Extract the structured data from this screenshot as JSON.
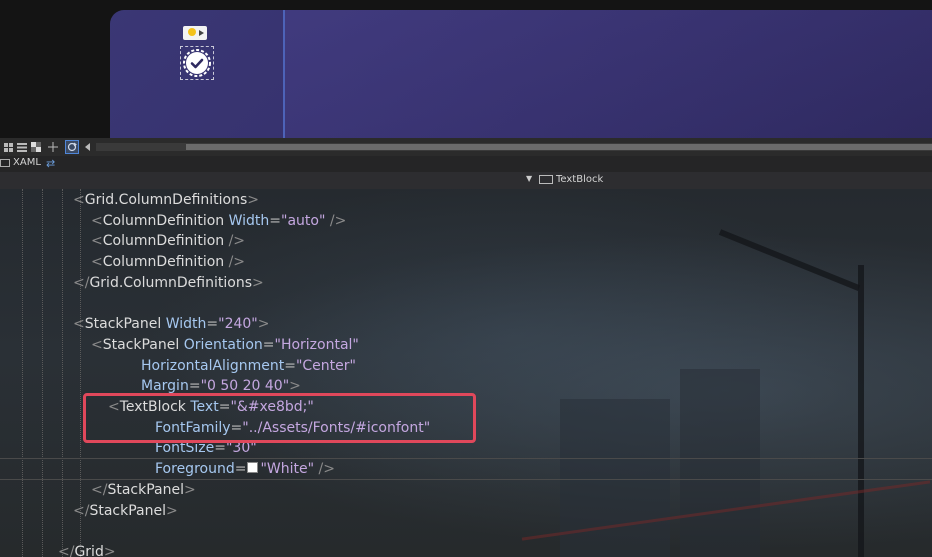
{
  "designer": {
    "icons": [
      "lightbulb-icon",
      "check-circle-icon"
    ]
  },
  "toolbar": {
    "buttons": [
      "grid-view-icon",
      "list-view-icon",
      "checker-icon",
      "crosshair-icon",
      "refresh-icon",
      "scroll-left-icon"
    ]
  },
  "tabs": {
    "xaml_label": "XAML",
    "swap_icon": "swap-icon"
  },
  "breadcrumb": {
    "element": "TextBlock"
  },
  "code": {
    "lines": [
      {
        "indent": 1,
        "parts": [
          [
            "tk",
            "<"
          ],
          [
            "tag",
            "Grid.ColumnDefinitions"
          ],
          [
            "tk",
            ">"
          ]
        ]
      },
      {
        "indent": 2,
        "parts": [
          [
            "tk",
            "<"
          ],
          [
            "tag",
            "ColumnDefinition "
          ],
          [
            "attr",
            "Width"
          ],
          [
            "eq",
            "="
          ],
          [
            "val",
            "\"auto\""
          ],
          [
            "tk",
            " />"
          ]
        ]
      },
      {
        "indent": 2,
        "parts": [
          [
            "tk",
            "<"
          ],
          [
            "tag",
            "ColumnDefinition "
          ],
          [
            "tk",
            "/>"
          ]
        ]
      },
      {
        "indent": 2,
        "parts": [
          [
            "tk",
            "<"
          ],
          [
            "tag",
            "ColumnDefinition "
          ],
          [
            "tk",
            "/>"
          ]
        ]
      },
      {
        "indent": 1,
        "parts": [
          [
            "tk",
            "</"
          ],
          [
            "tag",
            "Grid.ColumnDefinitions"
          ],
          [
            "tk",
            ">"
          ]
        ]
      },
      {
        "indent": 1,
        "parts": []
      },
      {
        "indent": 1,
        "parts": [
          [
            "tk",
            "<"
          ],
          [
            "tag",
            "StackPanel "
          ],
          [
            "attr",
            "Width"
          ],
          [
            "eq",
            "="
          ],
          [
            "val",
            "\"240\""
          ],
          [
            "tk",
            ">"
          ]
        ]
      },
      {
        "indent": 2,
        "parts": [
          [
            "tk",
            "<"
          ],
          [
            "tag",
            "StackPanel "
          ],
          [
            "attr",
            "Orientation"
          ],
          [
            "eq",
            "="
          ],
          [
            "val",
            "\"Horizontal\""
          ]
        ]
      },
      {
        "indent": 3,
        "parts": [
          [
            "attr",
            "HorizontalAlignment"
          ],
          [
            "eq",
            "="
          ],
          [
            "val",
            "\"Center\""
          ]
        ]
      },
      {
        "indent": 3,
        "parts": [
          [
            "attr",
            "Margin"
          ],
          [
            "eq",
            "="
          ],
          [
            "val",
            "\"0 50 20 40\""
          ],
          [
            "tk",
            ">"
          ]
        ]
      },
      {
        "indent": 4,
        "parts": [
          [
            "tk",
            "<"
          ],
          [
            "tag",
            "TextBlock "
          ],
          [
            "attr",
            "Text"
          ],
          [
            "eq",
            "="
          ],
          [
            "val",
            "\"&#xe8bd;\""
          ]
        ]
      },
      {
        "indent": 5,
        "parts": [
          [
            "attr",
            "FontFamily"
          ],
          [
            "eq",
            "="
          ],
          [
            "val",
            "\"../Assets/Fonts/#iconfont\""
          ]
        ]
      },
      {
        "indent": 5,
        "parts": [
          [
            "attr",
            "FontSize"
          ],
          [
            "eq",
            "="
          ],
          [
            "val",
            "\"30\""
          ]
        ]
      },
      {
        "indent": 5,
        "parts": [
          [
            "attr",
            "Foreground"
          ],
          [
            "eq",
            "="
          ],
          [
            "swatch",
            ""
          ],
          [
            "val",
            "\"White\""
          ],
          [
            "tk",
            " />"
          ]
        ]
      },
      {
        "indent": 2,
        "parts": [
          [
            "tk",
            "</"
          ],
          [
            "tag",
            "StackPanel"
          ],
          [
            "tk",
            ">"
          ]
        ]
      },
      {
        "indent": 1,
        "parts": [
          [
            "tk",
            "</"
          ],
          [
            "tag",
            "StackPanel"
          ],
          [
            "tk",
            ">"
          ]
        ]
      },
      {
        "indent": 1,
        "parts": []
      },
      {
        "indent": 0,
        "parts": [
          [
            "tk",
            "</"
          ],
          [
            "tag",
            "Grid"
          ],
          [
            "tk",
            ">"
          ]
        ]
      }
    ]
  },
  "colors": {
    "preview_bg": "#35306b",
    "highlight_border": "#e0485b",
    "attr": "#a6c8f0",
    "value": "#c4a7e0"
  }
}
